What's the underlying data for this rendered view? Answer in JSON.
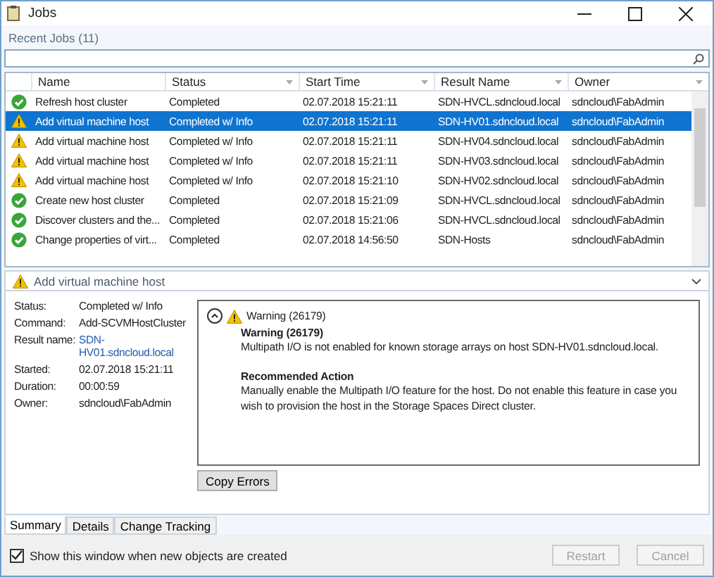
{
  "window": {
    "title": "Jobs"
  },
  "section_title": "Recent Jobs (11)",
  "table": {
    "columns": [
      "Name",
      "Status",
      "Start Time",
      "Result Name",
      "Owner"
    ],
    "rows": [
      {
        "kind": "ok",
        "selected": false,
        "cells": [
          "Refresh host cluster",
          "Completed",
          "02.07.2018 15:21:11",
          "SDN-HVCL.sdncloud.local",
          "sdncloud\\FabAdmin"
        ]
      },
      {
        "kind": "warning",
        "selected": true,
        "cells": [
          "Add virtual machine host",
          "Completed w/ Info",
          "02.07.2018 15:21:11",
          "SDN-HV01.sdncloud.local",
          "sdncloud\\FabAdmin"
        ]
      },
      {
        "kind": "warning",
        "selected": false,
        "cells": [
          "Add virtual machine host",
          "Completed w/ Info",
          "02.07.2018 15:21:11",
          "SDN-HV04.sdncloud.local",
          "sdncloud\\FabAdmin"
        ]
      },
      {
        "kind": "warning",
        "selected": false,
        "cells": [
          "Add virtual machine host",
          "Completed w/ Info",
          "02.07.2018 15:21:11",
          "SDN-HV03.sdncloud.local",
          "sdncloud\\FabAdmin"
        ]
      },
      {
        "kind": "warning",
        "selected": false,
        "cells": [
          "Add virtual machine host",
          "Completed w/ Info",
          "02.07.2018 15:21:10",
          "SDN-HV02.sdncloud.local",
          "sdncloud\\FabAdmin"
        ]
      },
      {
        "kind": "ok",
        "selected": false,
        "cells": [
          "Create new host cluster",
          "Completed",
          "02.07.2018 15:21:09",
          "SDN-HVCL.sdncloud.local",
          "sdncloud\\FabAdmin"
        ]
      },
      {
        "kind": "ok",
        "selected": false,
        "cells": [
          "Discover clusters and the...",
          "Completed",
          "02.07.2018 15:21:06",
          "SDN-HVCL.sdncloud.local",
          "sdncloud\\FabAdmin"
        ]
      },
      {
        "kind": "ok",
        "selected": false,
        "cells": [
          "Change properties of virt...",
          "Completed",
          "02.07.2018 14:56:50",
          "SDN-Hosts",
          "sdncloud\\FabAdmin"
        ]
      }
    ]
  },
  "detail": {
    "kind": "warning",
    "title": "Add virtual machine host",
    "fields": [
      {
        "label": "Status:",
        "value": "Completed w/ Info",
        "link": false
      },
      {
        "label": "Command:",
        "value": "Add-SCVMHostCluster",
        "link": false
      },
      {
        "label": "Result name:",
        "value": "SDN-HV01.sdncloud.local",
        "link": true
      },
      {
        "label": "Started:",
        "value": "02.07.2018 15:21:11",
        "link": false
      },
      {
        "label": "Duration:",
        "value": "00:00:59",
        "link": false
      },
      {
        "label": "Owner:",
        "value": "sdncloud\\FabAdmin",
        "link": false
      }
    ],
    "message": {
      "expanded": true,
      "header": "Warning (26179)",
      "title": "Warning (26179)",
      "text": "Multipath I/O is not enabled for known storage arrays on host SDN-HV01.sdncloud.local.",
      "action_title": "Recommended Action",
      "action_text": "Manually enable the Multipath I/O feature for the host. Do not enable this feature in case you wish to provision the host in the Storage Spaces Direct cluster."
    },
    "copy_button": "Copy Errors"
  },
  "tabs": [
    {
      "label": "Summary",
      "selected": true
    },
    {
      "label": "Details",
      "selected": false
    },
    {
      "label": "Change Tracking",
      "selected": false
    }
  ],
  "footer": {
    "checkbox": {
      "label": "Show this window when new objects are created",
      "checked": true
    },
    "buttons": [
      {
        "label": "Restart",
        "disabled": true
      },
      {
        "label": "Cancel",
        "disabled": true
      }
    ]
  }
}
